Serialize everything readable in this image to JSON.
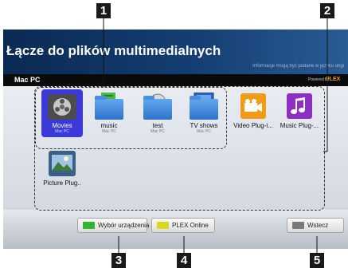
{
  "callouts": {
    "c1": "1",
    "c2": "2",
    "c3": "3",
    "c4": "4",
    "c5": "5"
  },
  "header": {
    "title": "Łącze do plików multimedialnych",
    "info": "Informacje mogą być podane w języku angi"
  },
  "source_bar": {
    "source": "Mac PC",
    "powered_by": "Powered by",
    "brand": "PLEX"
  },
  "devices": [
    {
      "label": "Movies",
      "sub": "Mac PC",
      "icon": "movie-reel-icon",
      "selected": true
    },
    {
      "label": "music",
      "sub": "Mac PC",
      "icon": "music-folder-icon"
    },
    {
      "label": "test",
      "sub": "Mac PC",
      "icon": "movie-folder-icon"
    },
    {
      "label": "TV shows",
      "sub": "Mac PC",
      "icon": "tv-folder-icon"
    }
  ],
  "plugins": [
    {
      "label": "Video Plug-i...",
      "icon": "video-camera-icon",
      "color": "#f29b16"
    },
    {
      "label": "Music Plug-...",
      "icon": "music-note-icon",
      "color": "#8d2fc3"
    },
    {
      "label": "Picture Plug..",
      "icon": "picture-icon"
    }
  ],
  "buttons": {
    "device": {
      "label": "Wybór urządzenia",
      "color": "#2fb52f"
    },
    "plex": {
      "label": "PLEX Online",
      "color": "#d8d81f"
    },
    "back": {
      "label": "Wstecz"
    }
  }
}
